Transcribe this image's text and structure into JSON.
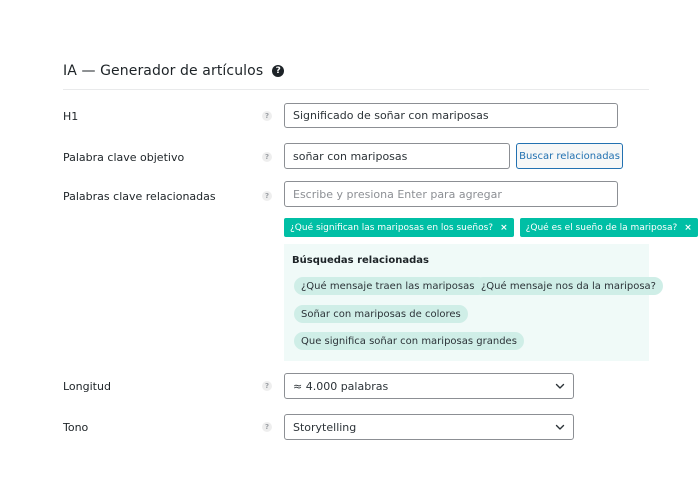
{
  "header": {
    "title": "IA — Generador de artículos",
    "help_icon": "question-circle-icon"
  },
  "fields": {
    "h1": {
      "label": "H1",
      "value": "Significado de soñar con mariposas"
    },
    "keyword": {
      "label": "Palabra clave objetivo",
      "value": "soñar con mariposas",
      "button_label": "Buscar relacionadas"
    },
    "related": {
      "label": "Palabras clave relacionadas",
      "placeholder": "Escribe y presiona Enter para agregar",
      "tags": [
        "¿Qué significan las mariposas en los sueños?",
        "¿Qué es el sueño de la mariposa?"
      ],
      "remove_symbol": "×"
    },
    "suggestions": {
      "title": "Búsquedas relacionadas",
      "items": [
        "¿Qué mensaje traen las mariposas?",
        "¿Qué mensaje nos da la mariposa?",
        "Soñar con mariposas de colores",
        "Que significa soñar con mariposas grandes"
      ]
    },
    "length": {
      "label": "Longitud",
      "value": "≈ 4.000 palabras"
    },
    "tone": {
      "label": "Tono",
      "value": "Storytelling"
    }
  },
  "help_symbol": "?",
  "colors": {
    "accent": "#00bfa5",
    "primary_link": "#2271b1",
    "suggest_bg": "#f0faf8",
    "pill_bg": "#cfeee7"
  }
}
